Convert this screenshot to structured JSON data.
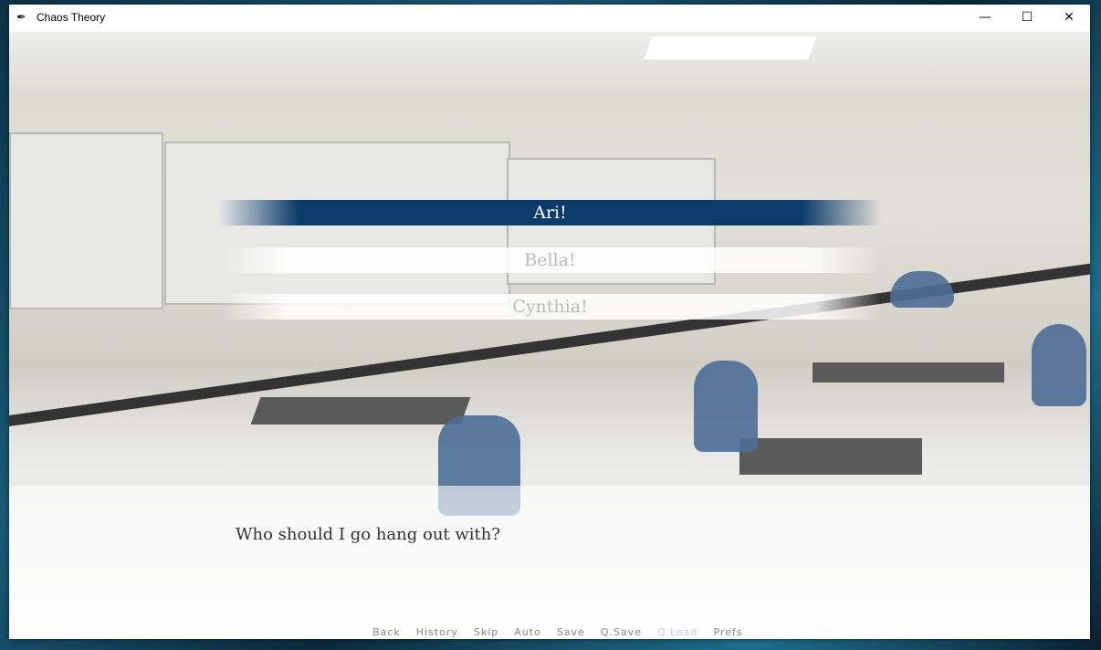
{
  "window": {
    "title": "Chaos Theory",
    "controls": {
      "minimize": "—",
      "maximize": "☐",
      "close": "✕"
    }
  },
  "menu": {
    "choices": [
      {
        "label": "Ari!",
        "selected": true
      },
      {
        "label": "Bella!",
        "selected": false
      },
      {
        "label": "Cynthia!",
        "selected": false
      }
    ]
  },
  "dialogue": {
    "text": "Who should I go hang out with?"
  },
  "quick_menu": [
    {
      "label": "Back",
      "enabled": true
    },
    {
      "label": "History",
      "enabled": true
    },
    {
      "label": "Skip",
      "enabled": true
    },
    {
      "label": "Auto",
      "enabled": true
    },
    {
      "label": "Save",
      "enabled": true
    },
    {
      "label": "Q.Save",
      "enabled": true
    },
    {
      "label": "Q.Load",
      "enabled": false
    },
    {
      "label": "Prefs",
      "enabled": true
    }
  ],
  "colors": {
    "selected_choice": "#0c3b6c",
    "dialogue_text": "#333333"
  }
}
